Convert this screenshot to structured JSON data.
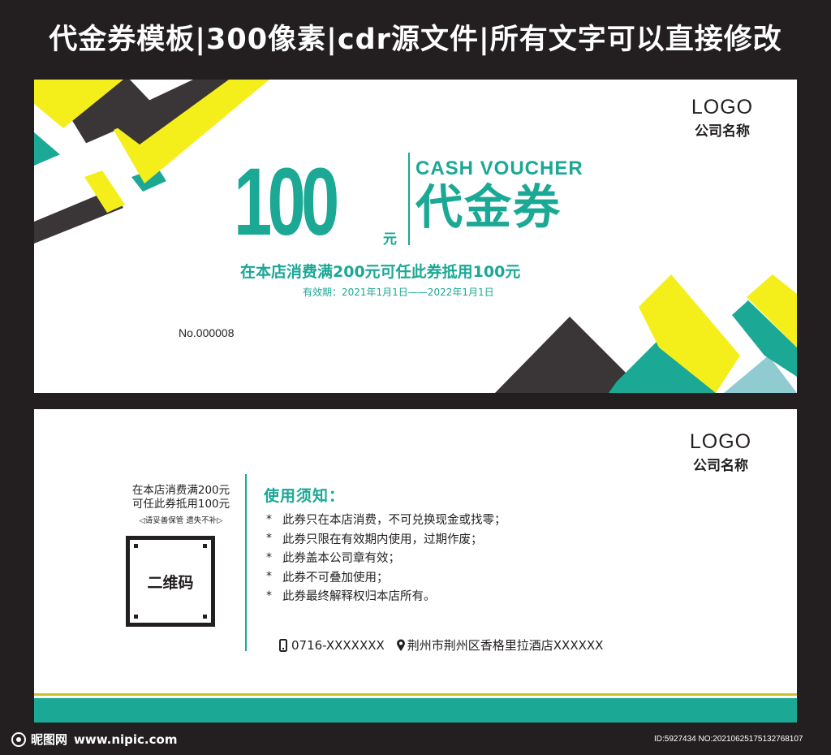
{
  "banner": {
    "title": "代金券模板|300像素|cdr源文件|所有文字可以直接修改"
  },
  "front": {
    "logo": "LOGO",
    "company": "公司名称",
    "amount": "100",
    "amount_unit": "元",
    "cash_voucher": "CASH VOUCHER",
    "voucher_word": "代金券",
    "condition": "在本店消费满200元可任此券抵用100元",
    "validity": "有效期：2021年1月1日——2022年1月1日",
    "serial": "No.000008"
  },
  "back": {
    "logo": "LOGO",
    "company": "公司名称",
    "note_line1": "在本店消费满200元",
    "note_line2": "可任此券抵用100元",
    "keep_note": "◁请妥善保管 遗失不补▷",
    "qr_label": "二维码",
    "usage_title": "使用须知：",
    "rules": [
      "此券只在本店消费，不可兑换现金或找零；",
      "此券只限在有效期内使用，过期作废；",
      "此券盖本公司章有效；",
      "此券不可叠加使用；",
      "此券最终解释权归本店所有。"
    ],
    "rule_marker": "*",
    "phone": "0716-XXXXXXX",
    "address": "荆州市荆州区香格里拉酒店XXXXXX"
  },
  "footer": {
    "site_name": "昵图网",
    "site_url": "www.nipic.com",
    "id_text": "ID:5927434 NO:20210625175132768107"
  },
  "icons": {
    "phone": "phone-icon",
    "location": "location-pin-icon",
    "site_logo": "nipic-logo-icon"
  },
  "colors": {
    "teal": "#1ba895",
    "yellow": "#f4ef1a",
    "dark": "#3a3536",
    "light_blue": "#8fcbd0",
    "background": "#231f20"
  }
}
